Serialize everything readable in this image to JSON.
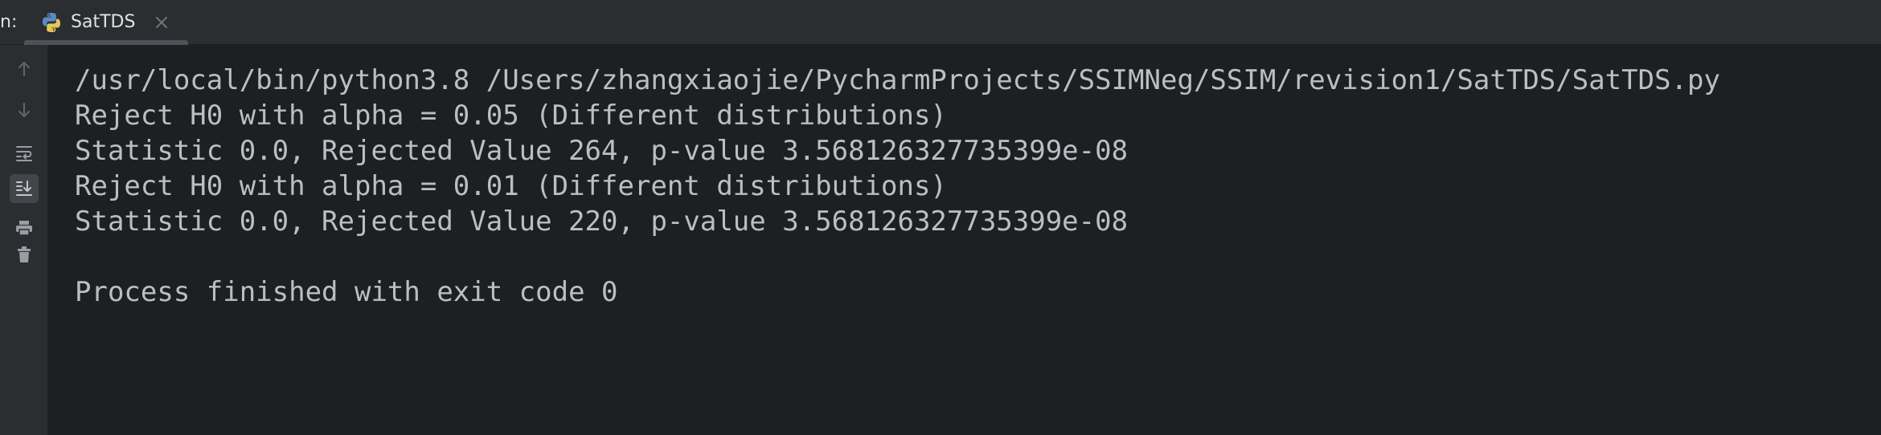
{
  "tab_bar": {
    "run_prefix": "n:",
    "tab": {
      "label": "SatTDS",
      "icon": "python-file-icon"
    }
  },
  "toolbar": {
    "items": [
      {
        "name": "up-arrow-icon",
        "active": false
      },
      {
        "name": "down-arrow-icon",
        "active": false
      },
      {
        "name": "soft-wrap-icon",
        "active": false
      },
      {
        "name": "scroll-to-end-icon",
        "active": true
      },
      {
        "name": "print-icon",
        "active": false
      },
      {
        "name": "trash-icon",
        "active": false
      }
    ]
  },
  "console": {
    "lines": [
      "/usr/local/bin/python3.8 /Users/zhangxiaojie/PycharmProjects/SSIMNeg/SSIM/revision1/SatTDS/SatTDS.py",
      "Reject H0 with alpha = 0.05 (Different distributions)",
      "Statistic 0.0, Rejected Value 264, p-value 3.568126327735399e-08",
      "Reject H0 with alpha = 0.01 (Different distributions)",
      "Statistic 0.0, Rejected Value 220, p-value 3.568126327735399e-08",
      "",
      "Process finished with exit code 0"
    ]
  },
  "colors": {
    "console_bg": "#1e1f22",
    "panel_bg": "#2b2d30",
    "text": "#bcbec4",
    "icon": "#8c8f96",
    "icon_dim": "#5f6268"
  }
}
